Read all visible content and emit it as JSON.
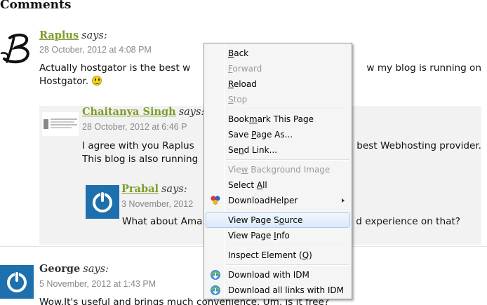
{
  "heading": "Comments",
  "comments": [
    {
      "author": "Raplus",
      "says": "says:",
      "date": "28 October, 2012 at 4:08 PM",
      "text_line1": "Actually hostgator is the best w",
      "text_line1_right": "w my blog is running on",
      "text_line2": "Hostgator."
    },
    {
      "author": "Chaitanya Singh",
      "says": "says:",
      "date": "28 October, 2012 at 6:46 P",
      "text_line1": "I agree with you Raplus",
      "text_line1_right": "best Webhosting provider.",
      "text_line2": "This blog is also running"
    },
    {
      "author": "Prabal",
      "says": "says:",
      "date": "3 November, 2012",
      "text_line1": "What about Ama",
      "text_line1_right": "d experience on that?"
    },
    {
      "author": "George",
      "says": "says:",
      "date": "5 November, 2012 at 1:43 PM",
      "text_line1": "Wow.It's useful and brings much convenience. Um, is it free?"
    }
  ],
  "context_menu": {
    "items": [
      {
        "label": "Back",
        "underline": "B"
      },
      {
        "label": "Forward",
        "underline": "F",
        "disabled": true
      },
      {
        "label": "Reload",
        "underline": "R"
      },
      {
        "label": "Stop",
        "underline": "S",
        "disabled": true
      },
      {
        "label": "Bookmark This Page",
        "underline": "m"
      },
      {
        "label": "Save Page As...",
        "underline": "P"
      },
      {
        "label": "Send Link...",
        "underline": "n"
      },
      {
        "label": "View Background Image",
        "underline": "w",
        "disabled": true
      },
      {
        "label": "Select All",
        "underline": "A"
      },
      {
        "label": "DownloadHelper",
        "icon": "downloadhelper-icon",
        "submenu": true
      },
      {
        "label": "View Page Source",
        "underline": "o",
        "highlighted": true
      },
      {
        "label": "View Page Info",
        "underline": "I"
      },
      {
        "label": "Inspect Element (Q)",
        "underline": "Q"
      },
      {
        "label": "Download with IDM",
        "icon": "idm-icon"
      },
      {
        "label": "Download all links with IDM",
        "icon": "idm-icon"
      }
    ]
  },
  "colors": {
    "author_link": "#7e9b2a",
    "meta_text": "#888888",
    "reply_background": "#f2f2f2",
    "menu_highlight": "#dbe9fb",
    "gravatar_blue": "#1d6fad"
  }
}
